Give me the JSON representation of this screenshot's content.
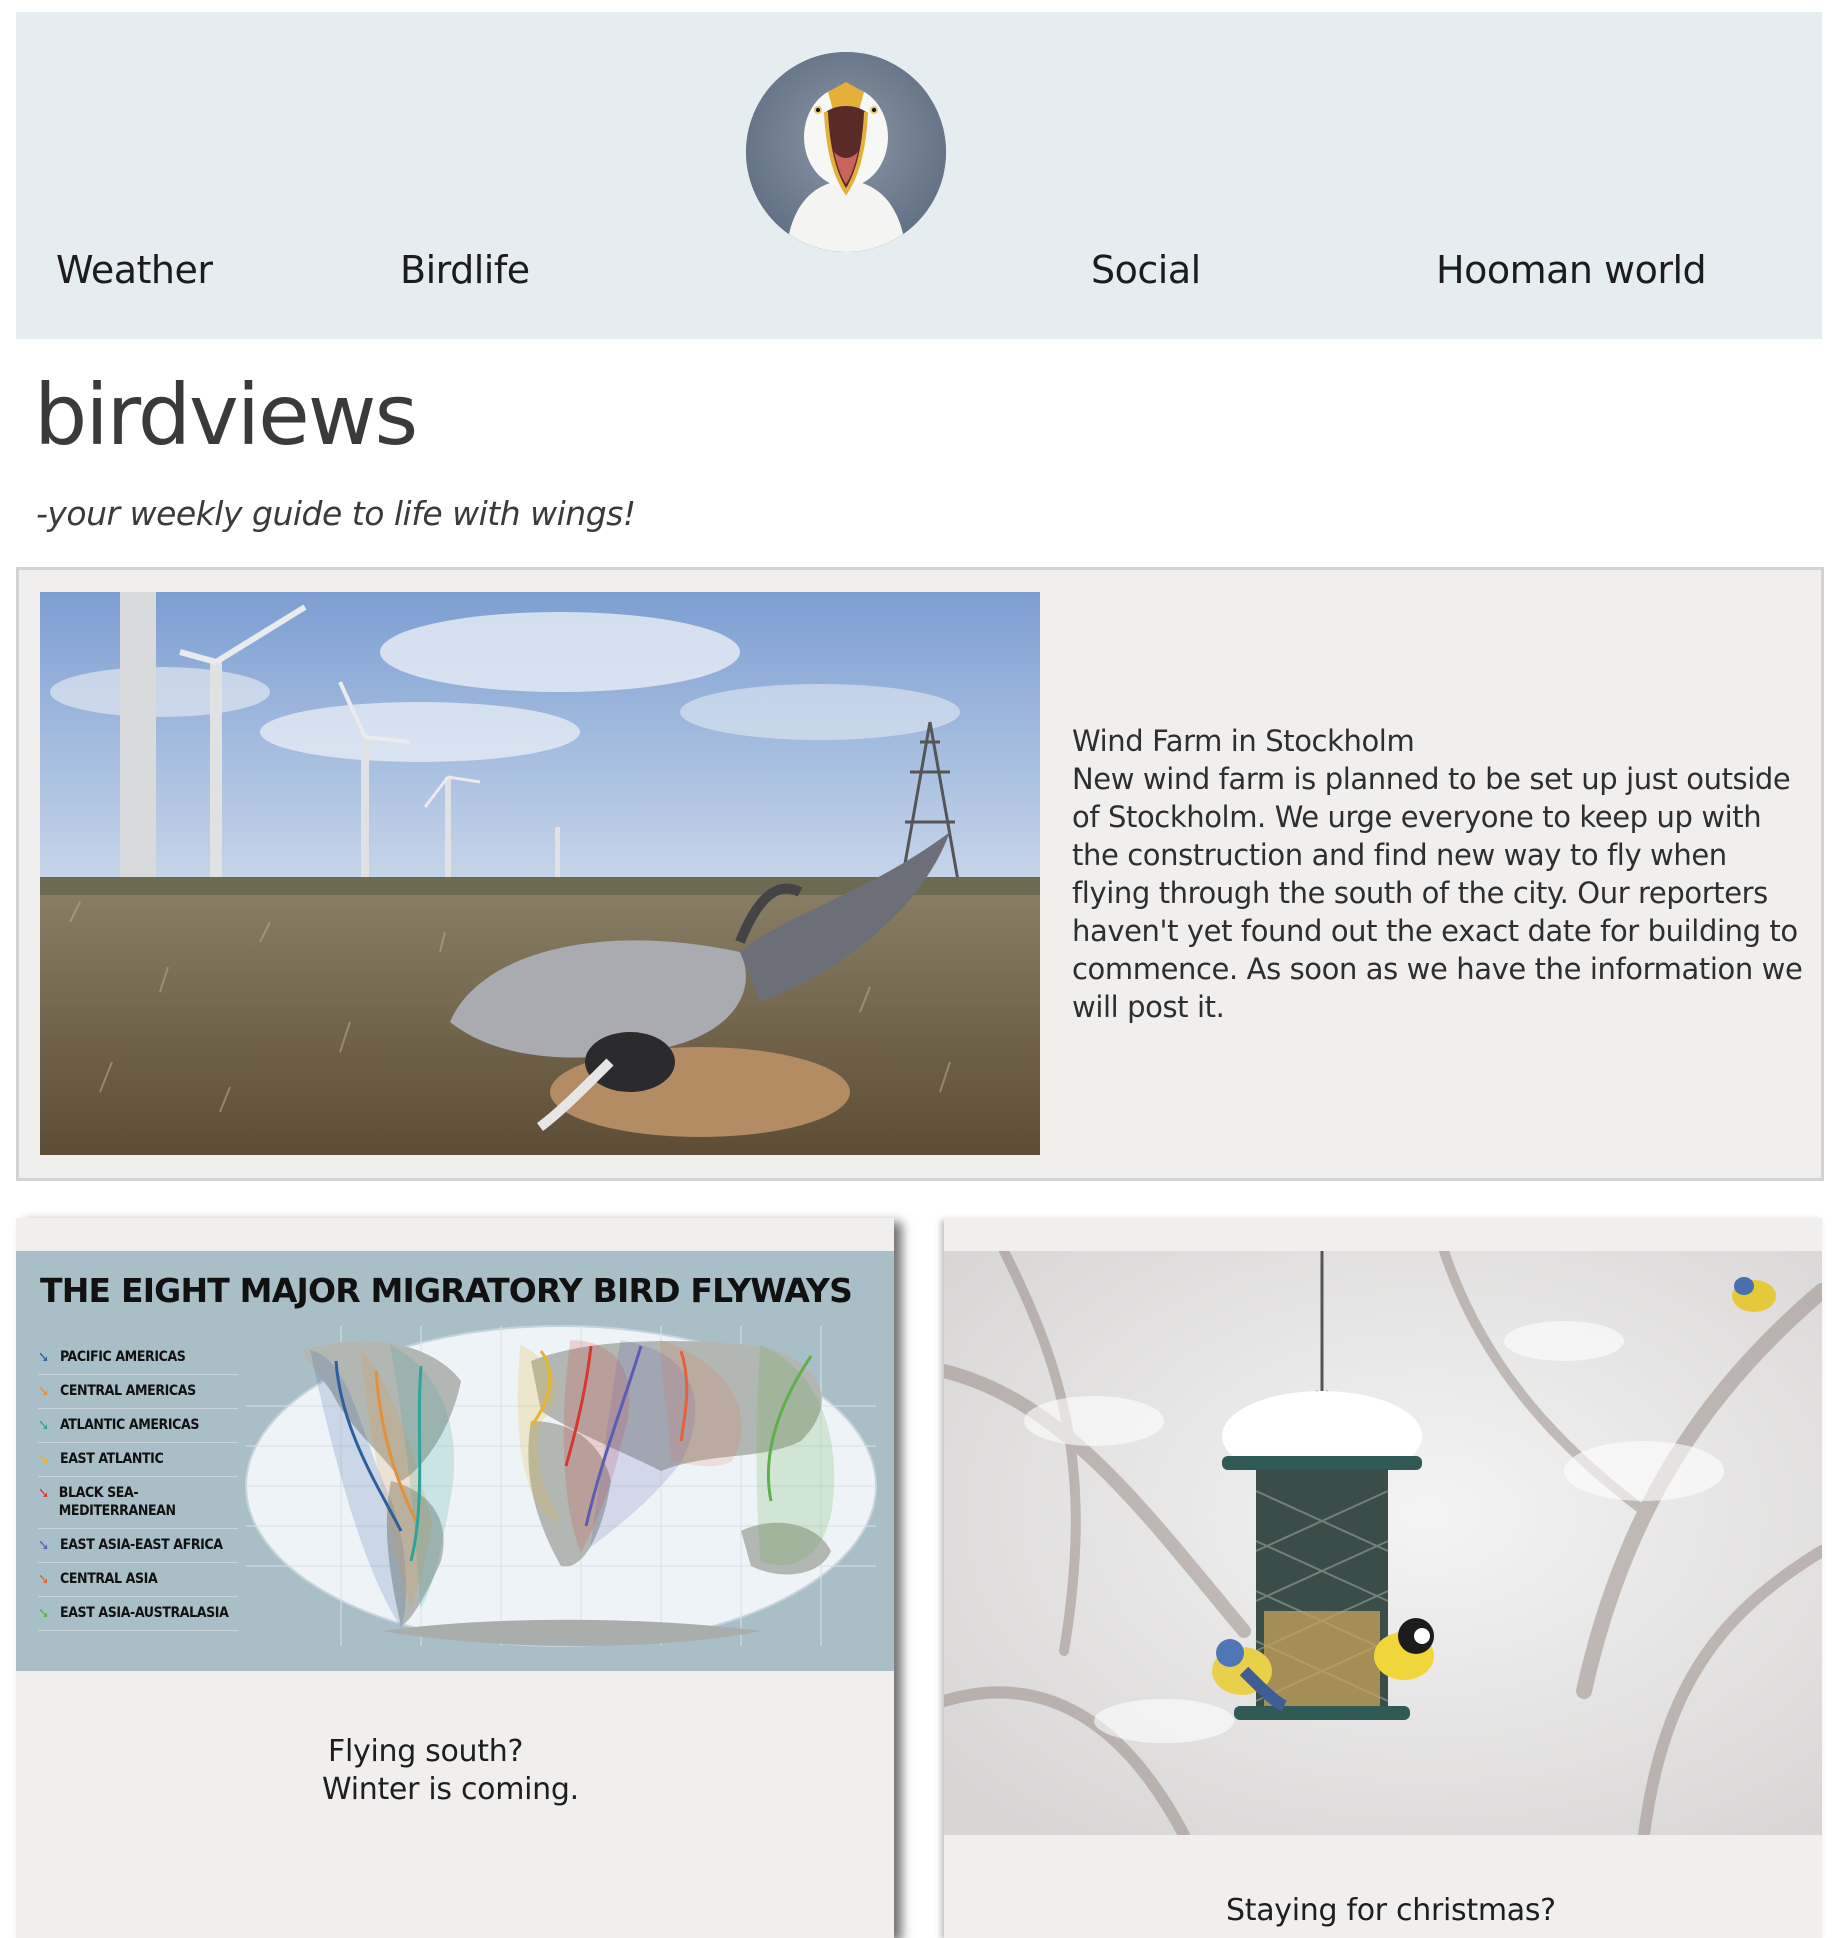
{
  "nav": {
    "links": [
      {
        "label": "Weather"
      },
      {
        "label": "Birdlife"
      },
      {
        "label": "Social"
      },
      {
        "label": "Hooman world"
      }
    ],
    "logo_icon": "screaming-seagull-logo"
  },
  "site": {
    "title": "birdviews",
    "tagline": "-your weekly guide to life with wings!"
  },
  "featured": {
    "title": "Wind Farm in Stockholm",
    "body": "New wind farm is planned to be set up just outside of Stockholm. We urge everyone to keep up with the construction and find new way to fly when flying through the south of the city. Our reporters haven't yet found out the exact date for building to commence. As soon as we have the information we will post it."
  },
  "cards": [
    {
      "title": "Flying south?",
      "subtitle": "Winter is coming.",
      "infographic": {
        "heading": "THE EIGHT MAJOR MIGRATORY BIRD FLYWAYS",
        "legend": [
          {
            "label": "PACIFIC AMERICAS",
            "color": "#2f5e9e"
          },
          {
            "label": "CENTRAL AMERICAS",
            "color": "#e0913a"
          },
          {
            "label": "ATLANTIC AMERICAS",
            "color": "#2fa39a"
          },
          {
            "label": "EAST ATLANTIC",
            "color": "#e7b52a"
          },
          {
            "label": "BLACK SEA-MEDITERRANEAN",
            "color": "#d8372f"
          },
          {
            "label": "EAST ASIA-EAST AFRICA",
            "color": "#5a5db3"
          },
          {
            "label": "CENTRAL ASIA",
            "color": "#e4623a"
          },
          {
            "label": "EAST ASIA-AUSTRALASIA",
            "color": "#5db04a"
          }
        ]
      }
    },
    {
      "title": "Staying for christmas?"
    }
  ]
}
